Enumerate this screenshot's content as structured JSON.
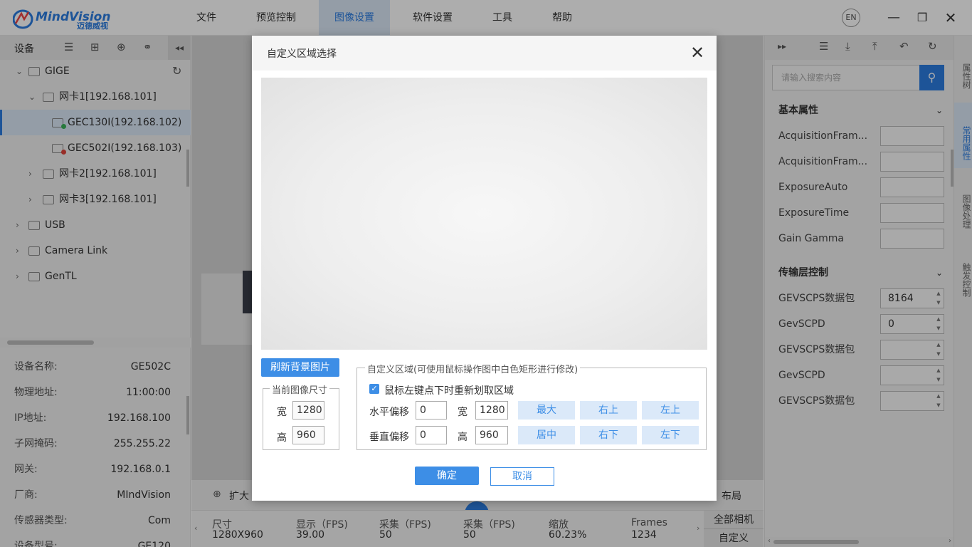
{
  "app": {
    "logo_text": "MindVision",
    "logo_sub": "迈德威视",
    "menus": [
      {
        "label": "文件"
      },
      {
        "label": "预览控制"
      },
      {
        "label": "图像设置"
      },
      {
        "label": "软件设置"
      },
      {
        "label": "工具"
      },
      {
        "label": "帮助"
      }
    ],
    "lang": "EN",
    "accent": "#2b7de1"
  },
  "left": {
    "header_label": "设备",
    "tree": [
      {
        "label": "GIGE"
      },
      {
        "label": "网卡1[192.168.101]"
      },
      {
        "label": "GEC130I(192.168.102)"
      },
      {
        "label": "GEC502I(192.168.103)"
      },
      {
        "label": "网卡2[192.168.101]"
      },
      {
        "label": "网卡3[192.168.101]"
      },
      {
        "label": "USB"
      },
      {
        "label": "Camera Link"
      },
      {
        "label": "GenTL"
      }
    ],
    "props": [
      {
        "k": "设备名称:",
        "v": "GE502C"
      },
      {
        "k": "物理地址:",
        "v": "11:00:00"
      },
      {
        "k": "IP地址:",
        "v": "192.168.100"
      },
      {
        "k": "子网掩码:",
        "v": "255.255.22"
      },
      {
        "k": "网关:",
        "v": "192.168.0.1"
      },
      {
        "k": "厂商:",
        "v": "MIndVision"
      },
      {
        "k": "传感器类型:",
        "v": "Com"
      },
      {
        "k": "设备型号:",
        "v": "GE120"
      }
    ]
  },
  "center": {
    "expand_label": "扩大",
    "layout_label": "布局",
    "stats": [
      {
        "k": "尺寸",
        "v": "1280X960"
      },
      {
        "k": "显示（FPS)",
        "v": "39.00"
      },
      {
        "k": "采集（FPS)",
        "v": "50"
      },
      {
        "k": "采集（FPS)",
        "v": "50"
      },
      {
        "k": "缩放",
        "v": "60.23%"
      },
      {
        "k": "Frames",
        "v": "1234"
      }
    ],
    "side_buttons": [
      "全部相机",
      "自定义"
    ]
  },
  "right": {
    "search_placeholder": "请输入搜索内容",
    "section1": "基本属性",
    "section2": "传输层控制",
    "basic": [
      {
        "k": "AcquisitionFram...",
        "v": ""
      },
      {
        "k": "AcquisitionFram...",
        "v": ""
      },
      {
        "k": "ExposureAuto",
        "v": ""
      },
      {
        "k": "ExposureTime",
        "v": ""
      },
      {
        "k": "Gain Gamma",
        "v": ""
      }
    ],
    "transport": [
      {
        "k": "GEVSCPS数据包",
        "v": "8164"
      },
      {
        "k": "GevSCPD",
        "v": "0"
      },
      {
        "k": "GEVSCPS数据包",
        "v": ""
      },
      {
        "k": "GevSCPD",
        "v": ""
      },
      {
        "k": "GEVSCPS数据包",
        "v": ""
      }
    ],
    "vtabs": [
      "属性树",
      "常用属性",
      "图像处理",
      "触发控制"
    ]
  },
  "dialog": {
    "title": "自定义区域选择",
    "refresh_label": "刷新背景图片",
    "current_size_group": "当前图像尺寸",
    "width_label": "宽",
    "height_label": "高",
    "current_width": "1280",
    "current_height": "960",
    "roi_group": "自定义区域(可使用鼠标操作图中白色矩形进行修改)",
    "checkbox_label": "鼠标左键点下时重新划取区域",
    "checkbox_checked": true,
    "h_offset_label": "水平偏移",
    "v_offset_label": "垂直偏移",
    "h_offset": "0",
    "v_offset": "0",
    "roi_width": "1280",
    "roi_height": "960",
    "pos_buttons": [
      "最大",
      "右上",
      "左上",
      "居中",
      "右下",
      "左下"
    ],
    "ok_label": "确定",
    "cancel_label": "取消"
  }
}
